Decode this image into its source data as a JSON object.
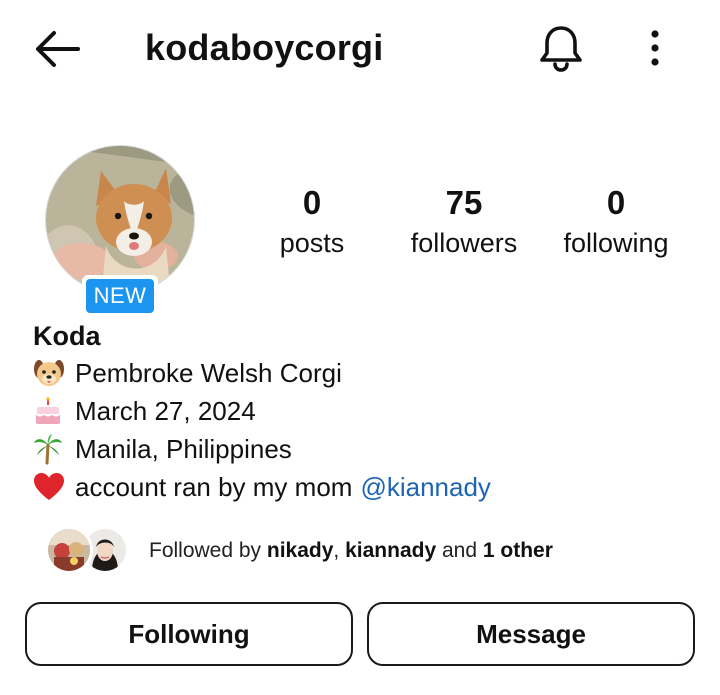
{
  "header": {
    "username": "kodaboycorgi",
    "back_icon": "arrow-left-icon",
    "notification_icon": "bell-icon",
    "more_icon": "more-vertical-icon"
  },
  "profile": {
    "badge": "NEW",
    "stats": [
      {
        "value": "0",
        "label": "posts"
      },
      {
        "value": "75",
        "label": "followers"
      },
      {
        "value": "0",
        "label": "following"
      }
    ]
  },
  "bio": {
    "name": "Koda",
    "lines": [
      {
        "emoji": "🐶",
        "text": "Pembroke Welsh Corgi"
      },
      {
        "emoji": "🎂",
        "text": "March 27, 2024"
      },
      {
        "emoji": "🌴",
        "text": "Manila, Philippines"
      },
      {
        "emoji": "❤️",
        "text": "account ran by my mom",
        "mention": "@kiannady"
      }
    ]
  },
  "followed_by": {
    "prefix": "Followed by ",
    "user1": "nikady",
    "sep": ", ",
    "user2": "kiannady",
    "and": " and ",
    "others": "1 other"
  },
  "actions": {
    "following_label": "Following",
    "message_label": "Message"
  },
  "colors": {
    "badge_blue": "#1b95f0",
    "link_blue": "#1d64b2",
    "heart_red": "#e0242b"
  }
}
